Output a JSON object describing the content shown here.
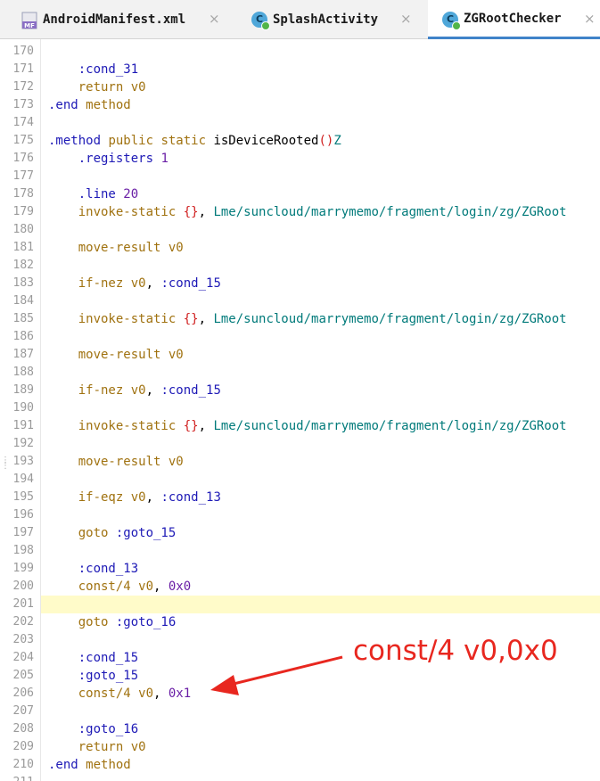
{
  "tabs": [
    {
      "label": "AndroidManifest.xml",
      "icon": "manifest-file-icon",
      "icon_text": "MF",
      "active": false
    },
    {
      "label": "SplashActivity",
      "icon": "class-file-icon",
      "icon_text": "C",
      "active": false
    },
    {
      "label": "ZGRootChecker",
      "icon": "class-file-icon",
      "icon_text": "C",
      "active": true
    }
  ],
  "close_glyph": "×",
  "caret_line": 201,
  "lines": [
    {
      "n": "170",
      "tokens": []
    },
    {
      "n": "171",
      "tokens": [
        [
          "label",
          "    :cond_31"
        ]
      ]
    },
    {
      "n": "172",
      "tokens": [
        [
          "kw",
          "    return "
        ],
        [
          "reg",
          "v0"
        ]
      ]
    },
    {
      "n": "173",
      "tokens": [
        [
          "dir",
          ".end "
        ],
        [
          "kw",
          "method"
        ]
      ]
    },
    {
      "n": "174",
      "tokens": []
    },
    {
      "n": "175",
      "tokens": [
        [
          "dir",
          ".method "
        ],
        [
          "kw",
          "public static "
        ],
        [
          "id",
          "isDeviceRooted"
        ],
        [
          "paren",
          "()"
        ],
        [
          "type",
          "Z"
        ]
      ]
    },
    {
      "n": "176",
      "tokens": [
        [
          "dir",
          "    .registers "
        ],
        [
          "num",
          "1"
        ]
      ]
    },
    {
      "n": "177",
      "tokens": []
    },
    {
      "n": "178",
      "tokens": [
        [
          "dir",
          "    .line "
        ],
        [
          "num",
          "20"
        ]
      ]
    },
    {
      "n": "179",
      "tokens": [
        [
          "kw",
          "    invoke-static "
        ],
        [
          "paren",
          "{}"
        ],
        [
          "punc",
          ", "
        ],
        [
          "type",
          "Lme/suncloud/marrymemo/fragment/login/zg/ZGRoot"
        ]
      ]
    },
    {
      "n": "180",
      "tokens": []
    },
    {
      "n": "181",
      "tokens": [
        [
          "kw",
          "    move-result "
        ],
        [
          "reg",
          "v0"
        ]
      ]
    },
    {
      "n": "182",
      "tokens": []
    },
    {
      "n": "183",
      "tokens": [
        [
          "kw",
          "    if-nez "
        ],
        [
          "reg",
          "v0"
        ],
        [
          "punc",
          ", "
        ],
        [
          "label",
          ":cond_15"
        ]
      ]
    },
    {
      "n": "184",
      "tokens": []
    },
    {
      "n": "185",
      "tokens": [
        [
          "kw",
          "    invoke-static "
        ],
        [
          "paren",
          "{}"
        ],
        [
          "punc",
          ", "
        ],
        [
          "type",
          "Lme/suncloud/marrymemo/fragment/login/zg/ZGRoot"
        ]
      ]
    },
    {
      "n": "186",
      "tokens": []
    },
    {
      "n": "187",
      "tokens": [
        [
          "kw",
          "    move-result "
        ],
        [
          "reg",
          "v0"
        ]
      ]
    },
    {
      "n": "188",
      "tokens": []
    },
    {
      "n": "189",
      "tokens": [
        [
          "kw",
          "    if-nez "
        ],
        [
          "reg",
          "v0"
        ],
        [
          "punc",
          ", "
        ],
        [
          "label",
          ":cond_15"
        ]
      ]
    },
    {
      "n": "190",
      "tokens": []
    },
    {
      "n": "191",
      "tokens": [
        [
          "kw",
          "    invoke-static "
        ],
        [
          "paren",
          "{}"
        ],
        [
          "punc",
          ", "
        ],
        [
          "type",
          "Lme/suncloud/marrymemo/fragment/login/zg/ZGRoot"
        ]
      ]
    },
    {
      "n": "192",
      "tokens": []
    },
    {
      "n": "193",
      "tokens": [
        [
          "kw",
          "    move-result "
        ],
        [
          "reg",
          "v0"
        ]
      ]
    },
    {
      "n": "194",
      "tokens": []
    },
    {
      "n": "195",
      "tokens": [
        [
          "kw",
          "    if-eqz "
        ],
        [
          "reg",
          "v0"
        ],
        [
          "punc",
          ", "
        ],
        [
          "label",
          ":cond_13"
        ]
      ]
    },
    {
      "n": "196",
      "tokens": []
    },
    {
      "n": "197",
      "tokens": [
        [
          "kw",
          "    goto "
        ],
        [
          "label",
          ":goto_15"
        ]
      ]
    },
    {
      "n": "198",
      "tokens": []
    },
    {
      "n": "199",
      "tokens": [
        [
          "label",
          "    :cond_13"
        ]
      ]
    },
    {
      "n": "200",
      "tokens": [
        [
          "kw",
          "    const/4 "
        ],
        [
          "reg",
          "v0"
        ],
        [
          "punc",
          ", "
        ],
        [
          "num",
          "0x0"
        ]
      ]
    },
    {
      "n": "201",
      "tokens": []
    },
    {
      "n": "202",
      "tokens": [
        [
          "kw",
          "    goto "
        ],
        [
          "label",
          ":goto_16"
        ]
      ]
    },
    {
      "n": "203",
      "tokens": []
    },
    {
      "n": "204",
      "tokens": [
        [
          "label",
          "    :cond_15"
        ]
      ]
    },
    {
      "n": "205",
      "tokens": [
        [
          "label",
          "    :goto_15"
        ]
      ]
    },
    {
      "n": "206",
      "tokens": [
        [
          "kw",
          "    const/4 "
        ],
        [
          "reg",
          "v0"
        ],
        [
          "punc",
          ", "
        ],
        [
          "num",
          "0x1"
        ]
      ]
    },
    {
      "n": "207",
      "tokens": []
    },
    {
      "n": "208",
      "tokens": [
        [
          "label",
          "    :goto_16"
        ]
      ]
    },
    {
      "n": "209",
      "tokens": [
        [
          "kw",
          "    return "
        ],
        [
          "reg",
          "v0"
        ]
      ]
    },
    {
      "n": "210",
      "tokens": [
        [
          "dir",
          ".end "
        ],
        [
          "kw",
          "method"
        ]
      ]
    },
    {
      "n": "211",
      "tokens": []
    }
  ],
  "annotation": {
    "text": "const/4 v0,0x0",
    "color": "#e8271f"
  },
  "colors": {
    "accent": "#4083c9",
    "caret_line": "#fffbc9",
    "annotation": "#e8271f"
  }
}
